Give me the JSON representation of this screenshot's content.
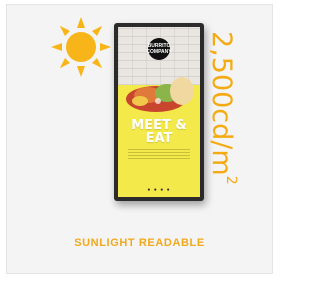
{
  "card": {
    "brightness_value": "2,500cd/m",
    "brightness_superscript": "2",
    "caption": "SUNLIGHT READABLE",
    "accent_color": "#f4ab13",
    "icons": [
      "sun-icon"
    ]
  },
  "screen": {
    "logo_line1": "BURRITO",
    "logo_line2": "COMPANY",
    "headline_line1": "MEET &",
    "headline_line2": "EAT",
    "dots": "● ● ● ●"
  }
}
